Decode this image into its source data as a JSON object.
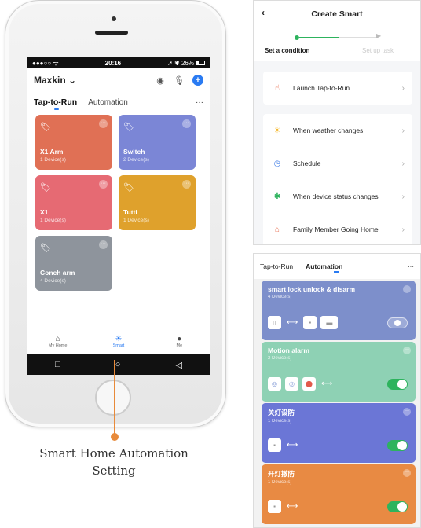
{
  "phone": {
    "status": {
      "left": "●●●○○ ᯤ",
      "time": "20:16",
      "right": "➚ ✱ 26%"
    },
    "home_name": "Maxkin",
    "home_tabs": {
      "tab1": "Tap-to-Run",
      "tab2": "Automation",
      "more": "···"
    },
    "tiles": [
      {
        "name": "X1 Arm",
        "count": "1 Device(s)",
        "color": "#e07055"
      },
      {
        "name": "Switch",
        "count": "2 Device(s)",
        "color": "#7b86d6"
      },
      {
        "name": "X1",
        "count": "1 Device(s)",
        "color": "#e66a73"
      },
      {
        "name": "Tutti",
        "count": "1 Device(s)",
        "color": "#dfa12c"
      },
      {
        "name": "Conch arm",
        "count": "4 Device(s)",
        "color": "#8e949c"
      }
    ],
    "nav": {
      "home": "My Home",
      "smart": "Smart",
      "me": "Me"
    }
  },
  "caption": {
    "line1": "Smart Home Automation",
    "line2": "Setting"
  },
  "create_smart": {
    "title": "Create Smart",
    "step1": "Set a condition",
    "step2": "Set up task",
    "launch": "Launch Tap-to-Run",
    "conditions": {
      "weather": "When weather changes",
      "schedule": "Schedule",
      "device": "When device status changes",
      "family": "Family Member Going Home"
    }
  },
  "automation_panel": {
    "tab1": "Tap-to-Run",
    "tab2": "Automation",
    "more": "···",
    "cards": [
      {
        "name": "smart lock unlock & disarm",
        "count": "4 Device(s)",
        "color": "#7d8fcb",
        "enabled": false
      },
      {
        "name": "Motion alarm",
        "count": "2 Device(s)",
        "color": "#8ed1b4",
        "enabled": true
      },
      {
        "name": "关灯设防",
        "count": "1 Device(s)",
        "color": "#6b76d6",
        "enabled": true
      },
      {
        "name": "开灯撤防",
        "count": "1 Device(s)",
        "color": "#e88a43",
        "enabled": true
      }
    ]
  },
  "colors": {
    "accent": "#2a7bf2",
    "green": "#2db35d",
    "callout": "#e88a3a"
  }
}
